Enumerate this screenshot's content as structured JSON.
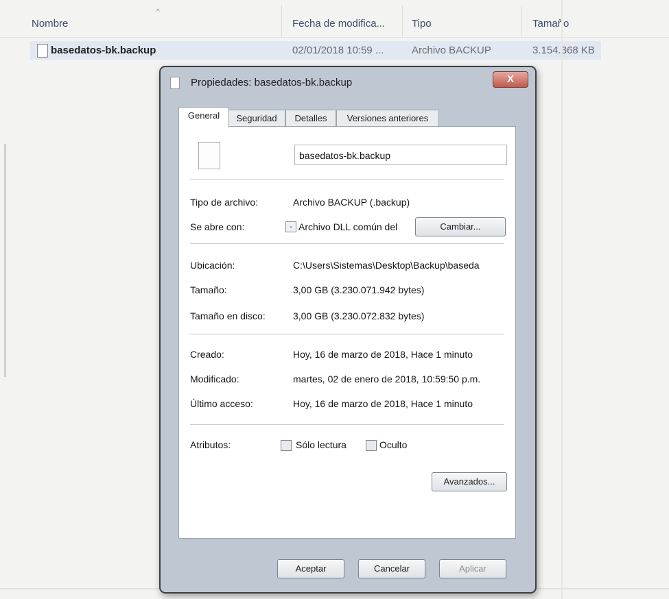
{
  "explorer": {
    "columns": [
      "Nombre",
      "Fecha de modifica...",
      "Tipo",
      "Tamaño"
    ],
    "file": {
      "name": "basedatos-bk.backup",
      "modified": "02/01/2018 10:59 ...",
      "type": "Archivo BACKUP",
      "size": "3.154.368 KB"
    }
  },
  "dialog": {
    "title": "Propiedades: basedatos-bk.backup",
    "close_label": "X",
    "tabs": [
      "General",
      "Seguridad",
      "Detalles",
      "Versiones anteriores"
    ],
    "filename": "basedatos-bk.backup",
    "type_label": "Tipo de archivo:",
    "type_value": "Archivo BACKUP (.backup)",
    "opens_label": "Se abre con:",
    "opens_value": "Archivo DLL común del",
    "change_button": "Cambiar...",
    "location_label": "Ubicación:",
    "location_value": "C:\\Users\\Sistemas\\Desktop\\Backup\\baseda",
    "size_label": "Tamaño:",
    "size_value": "3,00 GB (3.230.071.942 bytes)",
    "disk_label": "Tamaño en disco:",
    "disk_value": "3,00 GB (3.230.072.832 bytes)",
    "created_label": "Creado:",
    "created_value": "Hoy, 16 de marzo de 2018, Hace 1 minuto",
    "modified_label": "Modificado:",
    "modified_value": "martes, 02 de enero de 2018, 10:59:50 p.m.",
    "accessed_label": "Último acceso:",
    "accessed_value": "Hoy, 16 de marzo de 2018, Hace 1 minuto",
    "attributes_label": "Atributos:",
    "readonly_label": "Sólo lectura",
    "hidden_label": "Oculto",
    "advanced_button": "Avanzados...",
    "ok_button": "Aceptar",
    "cancel_button": "Cancelar",
    "apply_button": "Aplicar"
  }
}
